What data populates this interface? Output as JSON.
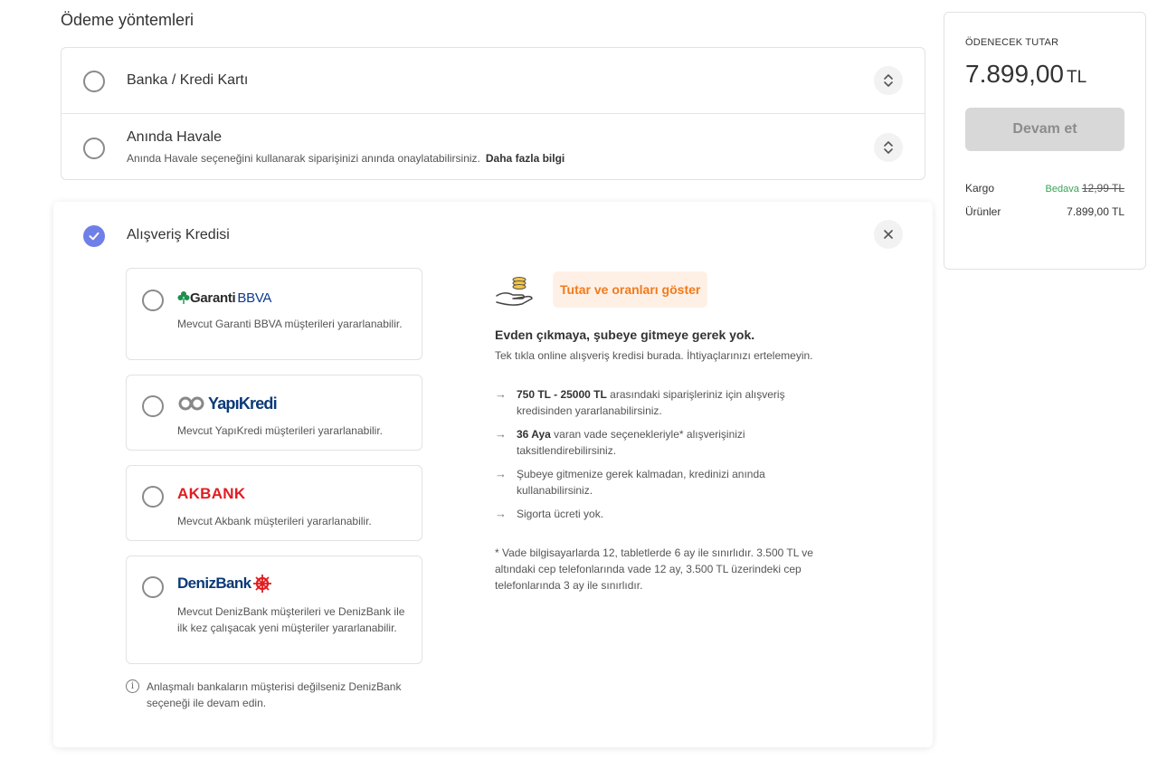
{
  "page": {
    "section_title": "Ödeme yöntemleri"
  },
  "methods": [
    {
      "title": "Banka / Kredi Kartı",
      "icon": "chevron-up-down-icon"
    },
    {
      "title": "Anında Havale",
      "description": "Anında Havale seçeneğini kullanarak siparişinizi anında onaylatabilirsiniz.",
      "more_link": "Daha fazla bilgi",
      "icon": "chevron-up-down-icon"
    }
  ],
  "credit": {
    "title": "Alışveriş Kredisi",
    "selected": true,
    "accent_color": "#6f7fe8",
    "banks": [
      {
        "logo_name": "Garanti",
        "logo_suffix": "BBVA",
        "description": "Mevcut Garanti BBVA müşterileri yararlanabilir."
      },
      {
        "logo_name": "YapıKredi",
        "description": "Mevcut YapıKredi müşterileri yararlanabilir."
      },
      {
        "logo_name": "AKBANK",
        "description": "Mevcut Akbank müşterileri yararlanabilir."
      },
      {
        "logo_name": "DenizBank",
        "description": "Mevcut DenizBank müşterileri ve DenizBank ile ilk kez çalışacak yeni müşteriler yararlanabilir."
      }
    ],
    "info_note": "Anlaşmalı bankaların müşterisi değilseniz DenizBank seçeneği ile devam edin.",
    "promo": {
      "badge": "Tutar ve oranları göster",
      "badge_color": "#f27a1a",
      "headline": "Evden çıkmaya, şubeye gitmeye gerek yok.",
      "subline": "Tek tıkla online alışveriş kredisi burada. İhtiyaçlarınızı ertelemeyin.",
      "benefits": [
        {
          "bold": "750 TL - 25000 TL",
          "text": " arasındaki siparişleriniz için alışveriş kredisinden yararlanabilirsiniz."
        },
        {
          "bold": "36 Aya",
          "text": " varan vade seçenekleriyle* alışverişinizi taksitlendirebilirsiniz."
        },
        {
          "bold": "",
          "text": "Şubeye gitmenize gerek kalmadan, kredinizi anında kullanabilirsiniz."
        },
        {
          "bold": "",
          "text": "Sigorta ücreti yok."
        }
      ],
      "footnote": "* Vade bilgisayarlarda 12, tabletlerde 6 ay ile sınırlıdır. 3.500 TL ve altındaki cep telefonlarında vade 12 ay, 3.500 TL üzerindeki cep telefonlarında 3 ay ile sınırlıdır."
    }
  },
  "summary": {
    "label": "ÖDENECEK TUTAR",
    "amount": "7.899,00",
    "currency": "TL",
    "continue_label": "Devam et",
    "cargo_label": "Kargo",
    "cargo_free": "Bedava",
    "cargo_old": "12,99 TL",
    "items_label": "Ürünler",
    "items_value": "7.899,00 TL",
    "free_color": "#3aa356"
  }
}
